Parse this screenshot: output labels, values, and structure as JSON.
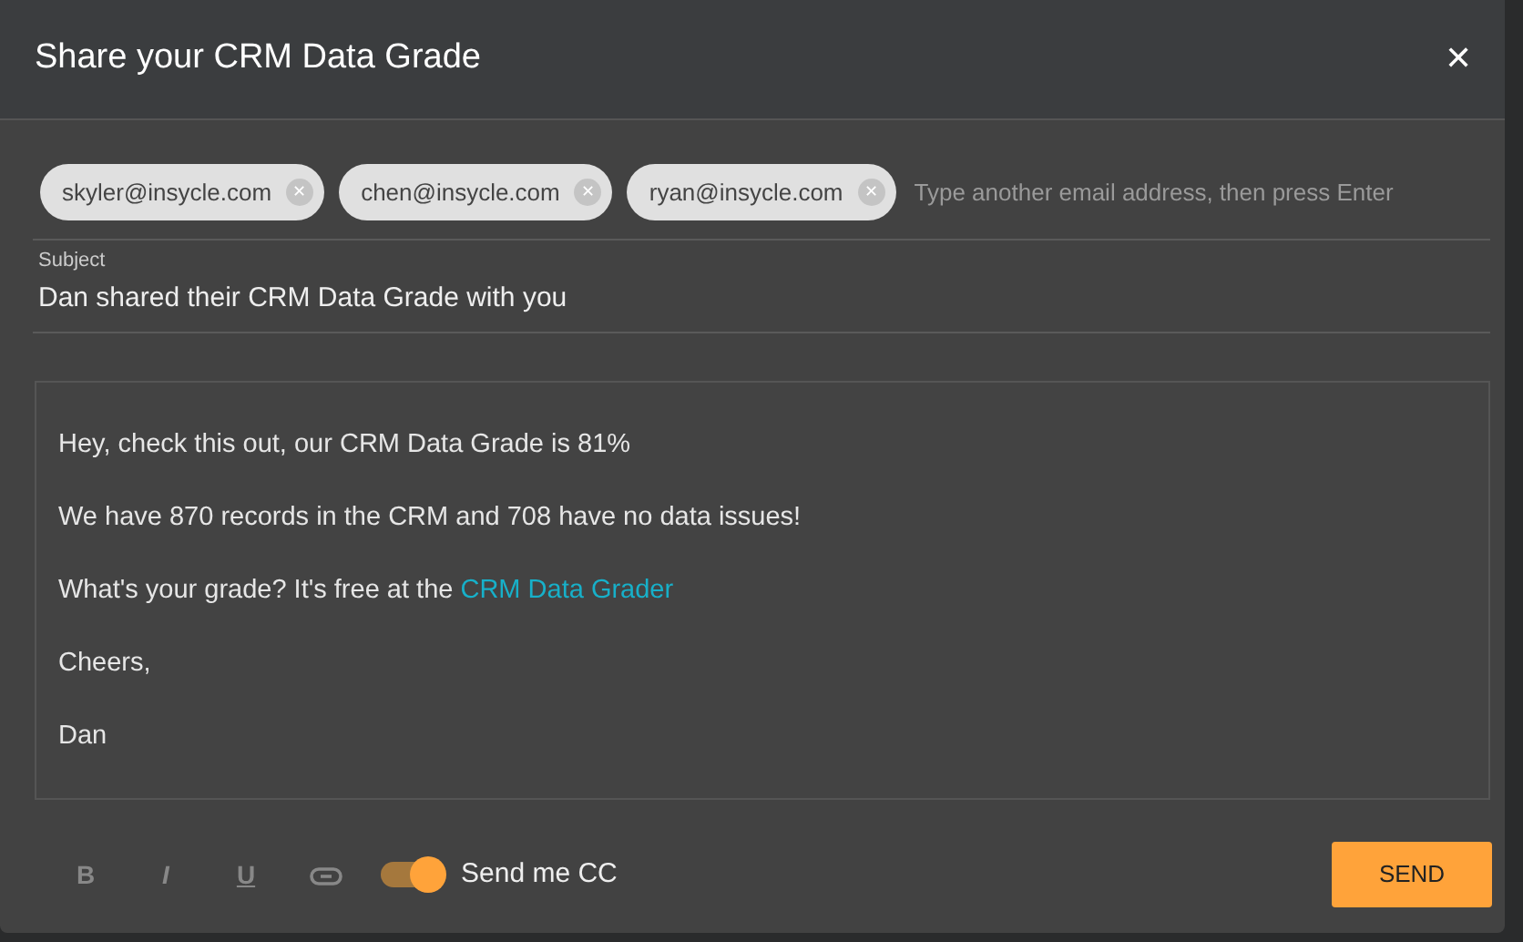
{
  "dialog": {
    "title": "Share your CRM Data Grade",
    "close": "✕"
  },
  "recipients": [
    {
      "email": "skyler@insycle.com",
      "remove": "✕"
    },
    {
      "email": "chen@insycle.com",
      "remove": "✕"
    },
    {
      "email": "ryan@insycle.com",
      "remove": "✕"
    }
  ],
  "recipient_input": {
    "placeholder": "Type another email address, then press Enter"
  },
  "subject": {
    "label": "Subject",
    "value": "Dan shared their CRM Data Grade with you"
  },
  "message": [
    {
      "text": "Hey, check this out, our CRM Data Grade is 81%"
    },
    {
      "text": "We have 870 records in the CRM and 708 have no data issues!"
    },
    {
      "text": "What's your grade? It's free at the ",
      "link": "CRM Data Grader"
    },
    {
      "text": "Cheers,"
    },
    {
      "text": "Dan"
    }
  ],
  "format_buttons": [
    {
      "kind": "bold",
      "label": "B"
    },
    {
      "kind": "italic",
      "label": "I"
    },
    {
      "kind": "underline",
      "label": "U"
    },
    {
      "kind": "link"
    }
  ],
  "send_me_cc": {
    "label": "Send me CC",
    "on": true
  },
  "send_button": "SEND"
}
